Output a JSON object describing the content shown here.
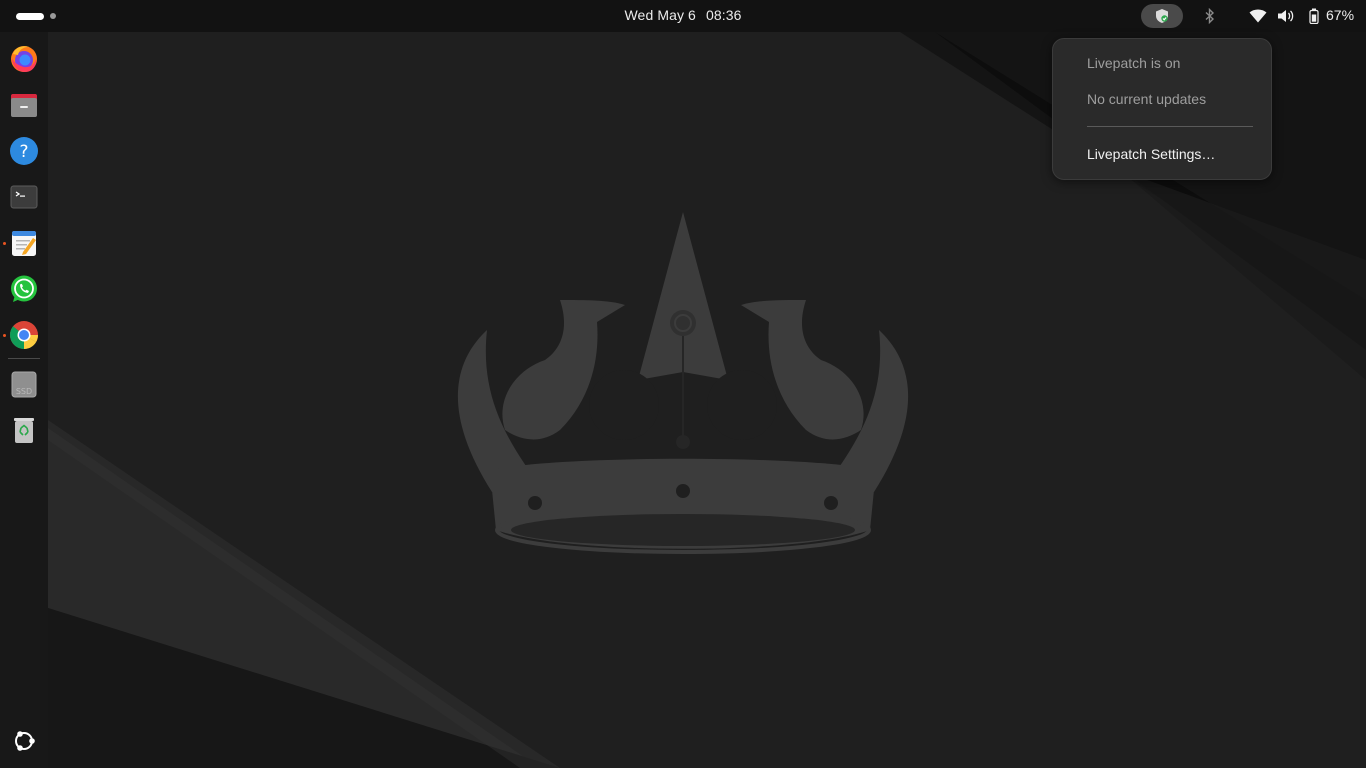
{
  "topbar": {
    "date": "Wed May 6",
    "time": "08:36",
    "battery_percent": "67%",
    "tray_icons": [
      "livepatch-shield-icon",
      "bluetooth-icon",
      "wifi-icon",
      "volume-icon",
      "battery-icon"
    ]
  },
  "dock": {
    "apps": [
      {
        "name": "Firefox",
        "icon": "firefox-icon",
        "running": false
      },
      {
        "name": "Files",
        "icon": "files-icon",
        "running": false
      },
      {
        "name": "Help",
        "icon": "help-icon",
        "running": false
      },
      {
        "name": "Terminal",
        "icon": "terminal-icon",
        "running": false
      },
      {
        "name": "Text Editor",
        "icon": "text-editor-icon",
        "running": true
      },
      {
        "name": "WhatsApp",
        "icon": "whatsapp-icon",
        "running": false
      },
      {
        "name": "Google Chrome",
        "icon": "chrome-icon",
        "running": true
      }
    ],
    "drives": [
      {
        "label": "SSD",
        "icon": "ssd-drive-icon"
      },
      {
        "name": "Trash",
        "icon": "trash-icon"
      }
    ],
    "show_apps_icon": "ubuntu-logo-icon"
  },
  "livepatch_menu": {
    "status": "Livepatch is on",
    "updates": "No current updates",
    "settings": "Livepatch Settings…"
  },
  "colors": {
    "ubuntu_orange": "#e95420",
    "panel": "#121212",
    "dock": "#181818",
    "wallpaper": "#1d1d1d"
  }
}
